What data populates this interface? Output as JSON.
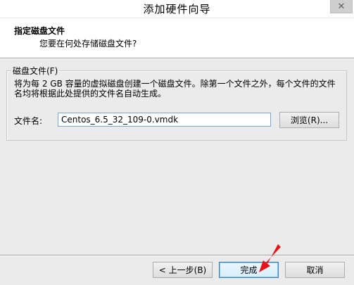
{
  "window": {
    "title": "添加硬件向导",
    "close_glyph": "✕"
  },
  "header": {
    "heading": "指定磁盘文件",
    "subheading": "您要在何处存储磁盘文件?"
  },
  "disk_file_group": {
    "legend": "磁盘文件(F)",
    "description": "将为每 2 GB 容量的虚拟磁盘创建一个磁盘文件。除第一个文件之外，每个文件的文件名均将根据此处提供的文件名自动生成。",
    "filename_label": "文件名:",
    "filename_value": "Centos_6.5_32_109-0.vmdk",
    "browse_label": "浏览(R)..."
  },
  "footer": {
    "back_label": "< 上一步(B)",
    "finish_label": "完成",
    "cancel_label": "取消"
  },
  "colors": {
    "annotation_arrow": "#e8141b",
    "window_background": "#ebebeb",
    "header_background": "#ffffff",
    "focus_border": "#3c7fb1"
  },
  "icons": {
    "close": "close-icon",
    "annotation": "red-arrow-annotation"
  }
}
